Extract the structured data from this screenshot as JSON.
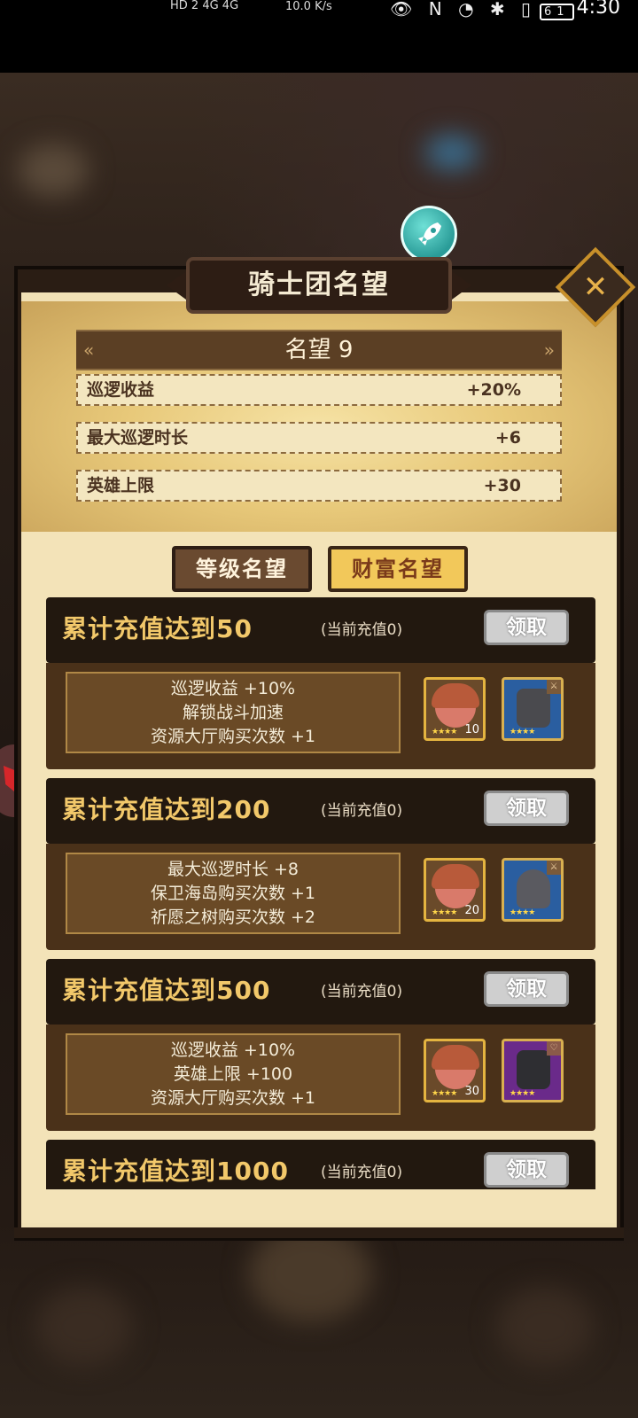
{
  "status_bar": {
    "left_indicators": "HD 2  4G  4G",
    "net_speed": "10.0 K/s",
    "battery": "61",
    "time": "4:30"
  },
  "dialog": {
    "title": "骑士团名望",
    "fame_level": "名望 9",
    "bonuses": [
      {
        "label": "巡逻收益",
        "value": "+20%"
      },
      {
        "label": "最大巡逻时长",
        "value": "+6"
      },
      {
        "label": "英雄上限",
        "value": "+30"
      }
    ],
    "tabs": [
      {
        "label": "等级名望",
        "active": false
      },
      {
        "label": "财富名望",
        "active": true
      }
    ],
    "rewards": [
      {
        "title": "累计充值达到50",
        "current": "(当前充值0)",
        "claim_label": "领取",
        "lines": [
          "巡逻收益 +10%",
          "解锁战斗加速",
          "资源大厅购买次数 +1"
        ],
        "hero_count": "10",
        "item_color": "#2a5ea0"
      },
      {
        "title": "累计充值达到200",
        "current": "(当前充值0)",
        "claim_label": "领取",
        "lines": [
          "最大巡逻时长 +8",
          "保卫海岛购买次数 +1",
          "祈愿之树购买次数 +2"
        ],
        "hero_count": "20",
        "item_color": "#2a5ea0"
      },
      {
        "title": "累计充值达到500",
        "current": "(当前充值0)",
        "claim_label": "领取",
        "lines": [
          "巡逻收益 +10%",
          "英雄上限 +100",
          "资源大厅购买次数 +1"
        ],
        "hero_count": "30",
        "item_color": "#6a2a8a"
      },
      {
        "title": "累计充值达到1000",
        "current": "(当前充值0)",
        "claim_label": "领取",
        "lines": [],
        "hero_count": "",
        "item_color": "#2a5ea0"
      }
    ]
  }
}
